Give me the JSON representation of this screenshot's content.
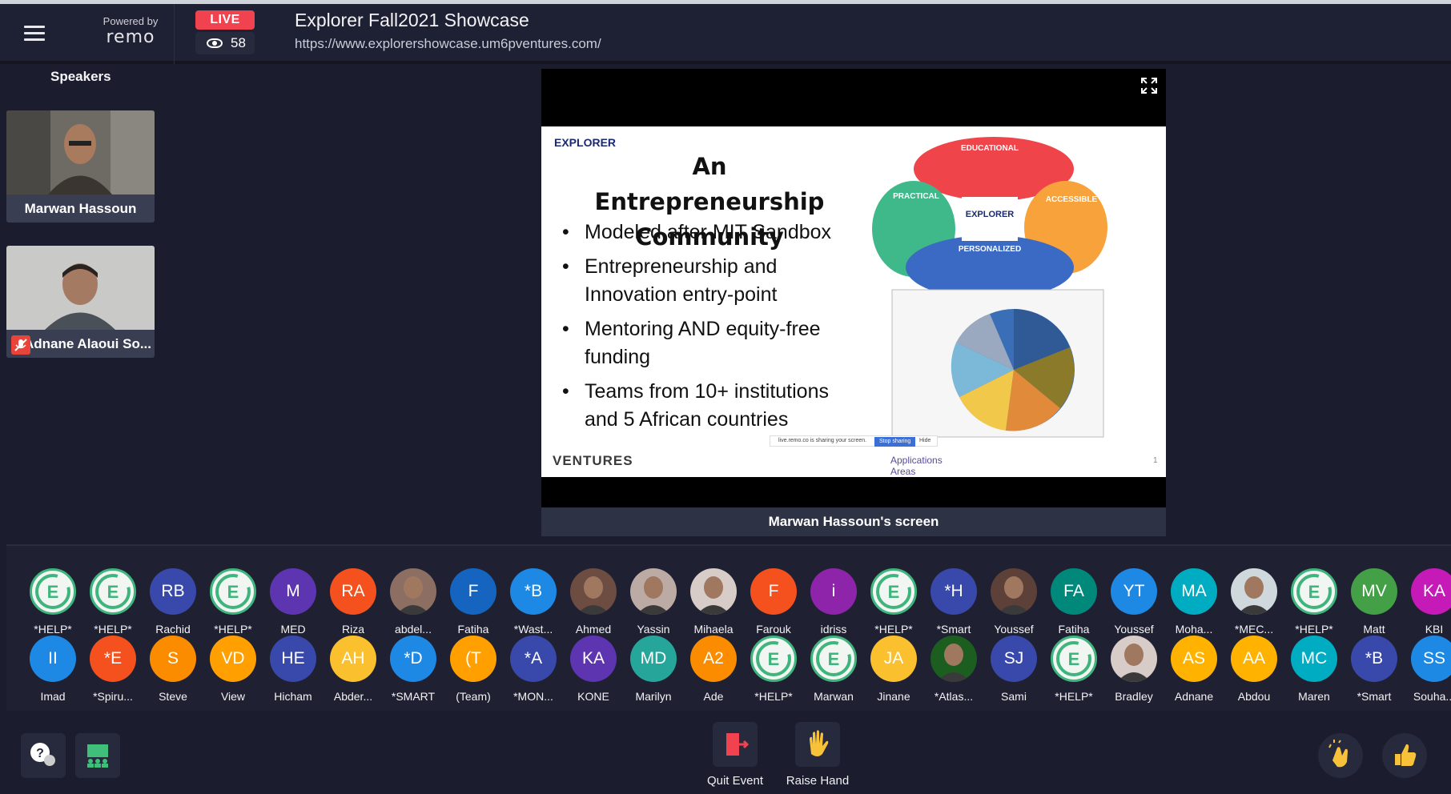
{
  "header": {
    "powered_by": "Powered by",
    "brand": "remo",
    "live_label": "LIVE",
    "viewer_count": "58",
    "event_title": "Explorer Fall2021 Showcase",
    "event_url": "https://www.explorershowcase.um6pventures.com/"
  },
  "speakers": {
    "title": "Speakers",
    "items": [
      {
        "name": "Marwan Hassoun",
        "muted": false
      },
      {
        "name": "Adnane Alaoui So...",
        "muted": true
      }
    ]
  },
  "screen": {
    "label": "Marwan Hassoun's screen",
    "slide": {
      "logo": "EXPLORER",
      "title": "An Entrepreneurship Community",
      "bullets": [
        "Modeled after MIT Sandbox",
        "Entrepreneurship and Innovation entry-point",
        "Mentoring AND equity-free funding",
        "Teams from 10+ institutions and 5 African countries"
      ],
      "footer_logo": "VENTURES",
      "applications_label": "Applications Areas",
      "diagram_labels": [
        "EDUCATIONAL",
        "PRACTICAL",
        "ACCESSIBLE",
        "PERSONALIZED"
      ],
      "center_label": "EXPLORER",
      "share_text": "live.remo.co is sharing your screen.",
      "stop_sharing": "Stop sharing",
      "hide": "Hide",
      "page_number": "1"
    }
  },
  "attendees": {
    "row1": [
      {
        "initials": "",
        "name": "*HELP*",
        "color": "#ffffff",
        "kind": "help"
      },
      {
        "initials": "",
        "name": "*HELP*",
        "color": "#ffffff",
        "kind": "help"
      },
      {
        "initials": "RB",
        "name": "Rachid",
        "color": "#3949ab"
      },
      {
        "initials": "",
        "name": "*HELP*",
        "color": "#ffffff",
        "kind": "help"
      },
      {
        "initials": "M",
        "name": "MED",
        "color": "#5e35b1"
      },
      {
        "initials": "RA",
        "name": "Riza",
        "color": "#f4511e"
      },
      {
        "initials": "",
        "name": "abdel...",
        "color": "#8d6e63",
        "kind": "photo"
      },
      {
        "initials": "F",
        "name": "Fatiha",
        "color": "#1565c0"
      },
      {
        "initials": "*B",
        "name": "*Wast...",
        "color": "#1e88e5"
      },
      {
        "initials": "",
        "name": "Ahmed",
        "color": "#6d4c41",
        "kind": "photo"
      },
      {
        "initials": "",
        "name": "Yassin",
        "color": "#bcaaa4",
        "kind": "photo"
      },
      {
        "initials": "",
        "name": "Mihaela",
        "color": "#d7ccc8",
        "kind": "photo"
      },
      {
        "initials": "F",
        "name": "Farouk",
        "color": "#f4511e"
      },
      {
        "initials": "i",
        "name": "idriss",
        "color": "#8e24aa"
      },
      {
        "initials": "",
        "name": "*HELP*",
        "color": "#ffffff",
        "kind": "help"
      },
      {
        "initials": "*H",
        "name": "*Smart",
        "color": "#3949ab"
      },
      {
        "initials": "",
        "name": "Youssef",
        "color": "#5d4037",
        "kind": "photo"
      },
      {
        "initials": "FA",
        "name": "Fatiha",
        "color": "#00897b"
      },
      {
        "initials": "YT",
        "name": "Youssef",
        "color": "#1e88e5"
      },
      {
        "initials": "MA",
        "name": "Moha...",
        "color": "#00acc1"
      },
      {
        "initials": "",
        "name": "*MEC...",
        "color": "#cfd8dc",
        "kind": "photo"
      },
      {
        "initials": "",
        "name": "*HELP*",
        "color": "#ffffff",
        "kind": "help"
      },
      {
        "initials": "MV",
        "name": "Matt",
        "color": "#43a047"
      },
      {
        "initials": "KA",
        "name": "KBI",
        "color": "#c51ab8"
      }
    ],
    "row2": [
      {
        "initials": "II",
        "name": "Imad",
        "color": "#1e88e5"
      },
      {
        "initials": "*E",
        "name": "*Spiru...",
        "color": "#f4511e"
      },
      {
        "initials": "S",
        "name": "Steve",
        "color": "#fb8c00"
      },
      {
        "initials": "VD",
        "name": "View",
        "color": "#ffa000"
      },
      {
        "initials": "HE",
        "name": "Hicham",
        "color": "#3949ab"
      },
      {
        "initials": "AH",
        "name": "Abder...",
        "color": "#fbc02d"
      },
      {
        "initials": "*D",
        "name": "*SMART",
        "color": "#1e88e5"
      },
      {
        "initials": "(T",
        "name": "(Team)",
        "color": "#ffa000"
      },
      {
        "initials": "*A",
        "name": "*MON...",
        "color": "#3949ab"
      },
      {
        "initials": "KA",
        "name": "KONE",
        "color": "#5e35b1"
      },
      {
        "initials": "MD",
        "name": "Marilyn",
        "color": "#26a69a"
      },
      {
        "initials": "A2",
        "name": "Ade",
        "color": "#fb8c00"
      },
      {
        "initials": "",
        "name": "*HELP*",
        "color": "#ffffff",
        "kind": "help"
      },
      {
        "initials": "",
        "name": "Marwan",
        "color": "#ffffff",
        "kind": "help"
      },
      {
        "initials": "JA",
        "name": "Jinane",
        "color": "#fbc02d"
      },
      {
        "initials": "",
        "name": "*Atlas...",
        "color": "#1b5e20",
        "kind": "photo"
      },
      {
        "initials": "SJ",
        "name": "Sami",
        "color": "#3949ab"
      },
      {
        "initials": "",
        "name": "*HELP*",
        "color": "#ffffff",
        "kind": "help"
      },
      {
        "initials": "",
        "name": "Bradley",
        "color": "#d7ccc8",
        "kind": "photo"
      },
      {
        "initials": "AS",
        "name": "Adnane",
        "color": "#ffb300"
      },
      {
        "initials": "AA",
        "name": "Abdou",
        "color": "#ffb300"
      },
      {
        "initials": "MC",
        "name": "Maren",
        "color": "#00acc1"
      },
      {
        "initials": "*B",
        "name": "*Smart",
        "color": "#3949ab"
      },
      {
        "initials": "SS",
        "name": "Souha...",
        "color": "#1e88e5"
      }
    ]
  },
  "bottom": {
    "quit_label": "Quit Event",
    "raise_label": "Raise Hand"
  }
}
